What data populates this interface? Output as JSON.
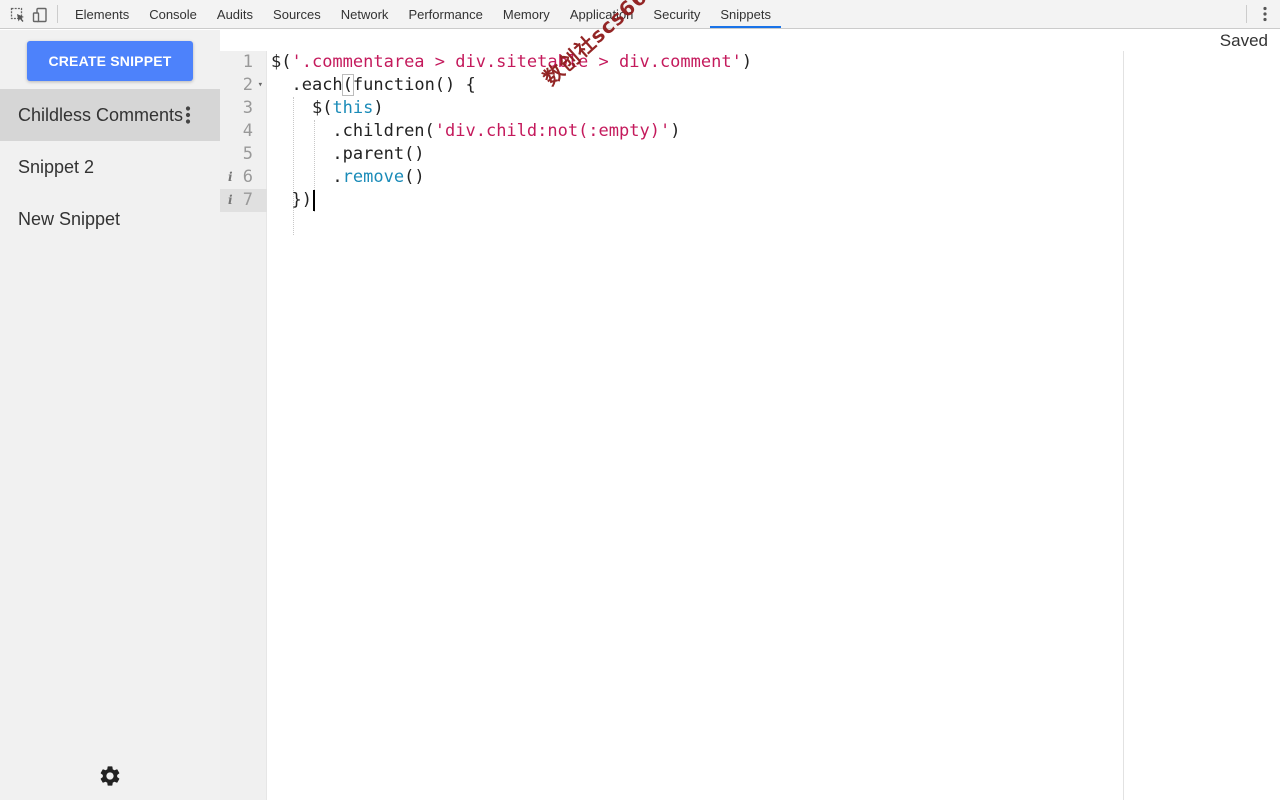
{
  "toolbar": {
    "tabs": [
      {
        "label": "Elements"
      },
      {
        "label": "Console"
      },
      {
        "label": "Audits"
      },
      {
        "label": "Sources"
      },
      {
        "label": "Network"
      },
      {
        "label": "Performance"
      },
      {
        "label": "Memory"
      },
      {
        "label": "Application"
      },
      {
        "label": "Security"
      },
      {
        "label": "Snippets"
      }
    ],
    "active_tab": "Snippets",
    "accent_color": "#1a73e8"
  },
  "sidebar": {
    "create_button_label": "CREATE SNIPPET",
    "create_button_color": "#4d82fb",
    "snippets": [
      {
        "label": "Childless Comments",
        "selected": true
      },
      {
        "label": "Snippet 2",
        "selected": false
      },
      {
        "label": "New Snippet",
        "selected": false
      }
    ],
    "settings_icon": "gear-icon"
  },
  "status": {
    "saved_label": "Saved"
  },
  "editor": {
    "line_numbers": [
      "1",
      "2",
      "3",
      "4",
      "5",
      "6",
      "7"
    ],
    "current_line": 7,
    "info_markers_on_lines": [
      6,
      7
    ],
    "fold_marker_on_line": 2,
    "lines": [
      {
        "indent": "",
        "parts": [
          {
            "t": "$(",
            "c": ""
          },
          {
            "t": "'.commentarea > div.sitetable > div.comment'",
            "c": "str2"
          },
          {
            "t": ")",
            "c": ""
          }
        ]
      },
      {
        "indent": "  ",
        "parts": [
          {
            "t": ".each",
            "c": ""
          },
          {
            "t": "(",
            "c": "box"
          },
          {
            "t": "function() {",
            "c": ""
          }
        ]
      },
      {
        "indent": "    ",
        "parts": [
          {
            "t": "$(",
            "c": ""
          },
          {
            "t": "this",
            "c": "kw"
          },
          {
            "t": ")",
            "c": ""
          }
        ]
      },
      {
        "indent": "      ",
        "parts": [
          {
            "t": ".children(",
            "c": ""
          },
          {
            "t": "'div.child:not(:empty)'",
            "c": "str2"
          },
          {
            "t": ")",
            "c": ""
          }
        ]
      },
      {
        "indent": "      ",
        "parts": [
          {
            "t": ".parent()",
            "c": ""
          }
        ]
      },
      {
        "indent": "      ",
        "parts": [
          {
            "t": ".",
            "c": ""
          },
          {
            "t": "remove",
            "c": "kw"
          },
          {
            "t": "()",
            "c": ""
          }
        ]
      },
      {
        "indent": "  ",
        "parts": [
          {
            "t": "})",
            "c": ""
          }
        ]
      }
    ]
  },
  "watermark": {
    "text": "数创社scs66"
  }
}
